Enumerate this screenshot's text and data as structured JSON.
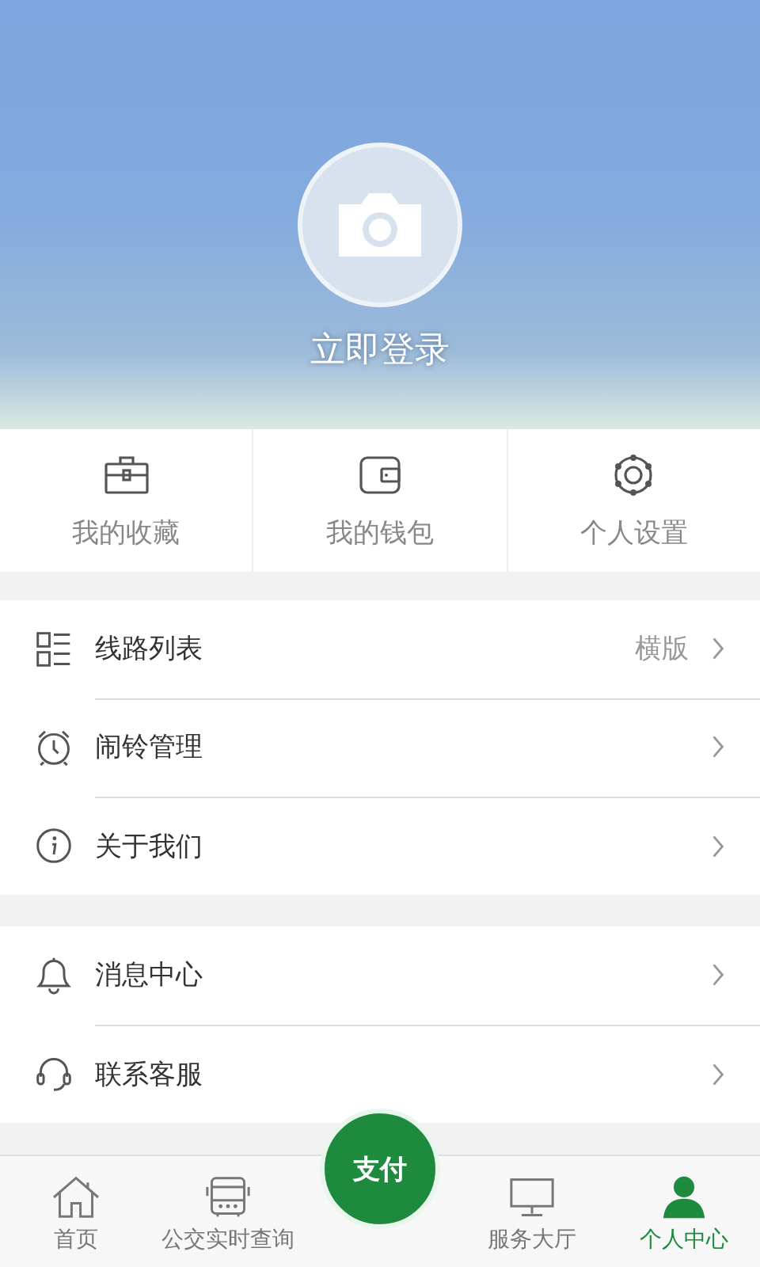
{
  "profile": {
    "login_label": "立即登录"
  },
  "shortcuts": [
    {
      "kind": "briefcase",
      "label": "我的收藏"
    },
    {
      "kind": "wallet",
      "label": "我的钱包"
    },
    {
      "kind": "gear",
      "label": "个人设置"
    }
  ],
  "menu_groups": [
    [
      {
        "kind": "list",
        "label": "线路列表",
        "value": "横版"
      },
      {
        "kind": "alarm",
        "label": "闹铃管理"
      },
      {
        "kind": "info",
        "label": "关于我们"
      }
    ],
    [
      {
        "kind": "bell",
        "label": "消息中心"
      },
      {
        "kind": "headset",
        "label": "联系客服"
      }
    ]
  ],
  "tabs": [
    {
      "kind": "home",
      "label": "首页",
      "selected": false
    },
    {
      "kind": "bus",
      "label": "公交实时查询",
      "selected": false
    },
    {
      "kind": "pay",
      "label": "支付",
      "selected": false
    },
    {
      "kind": "monitor",
      "label": "服务大厅",
      "selected": false
    },
    {
      "kind": "person",
      "label": "个人中心",
      "selected": true
    }
  ]
}
